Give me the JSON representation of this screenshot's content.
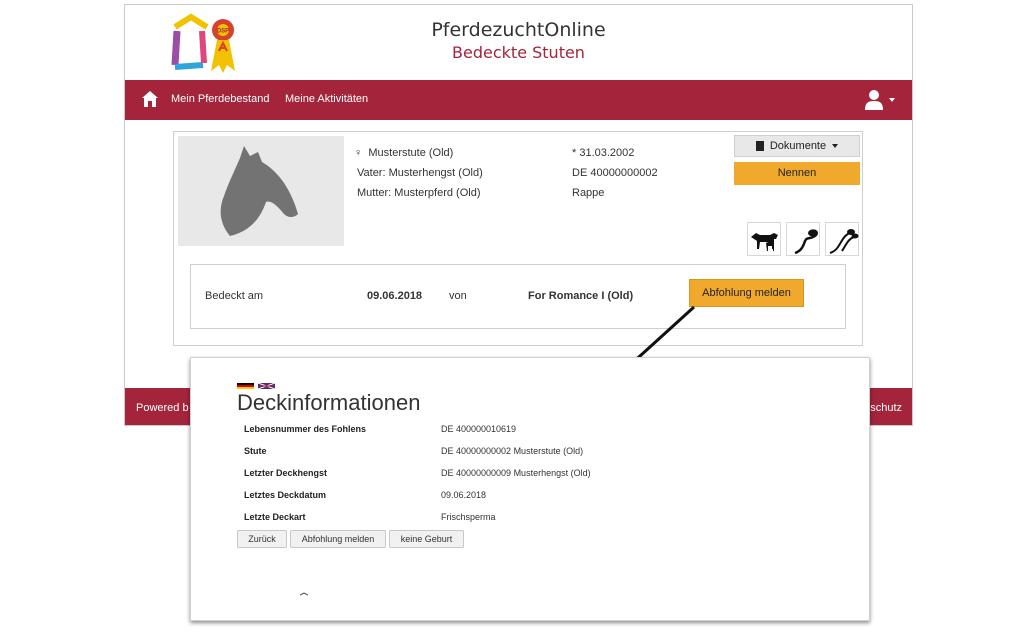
{
  "header": {
    "site_title": "PferdezuchtOnline",
    "page_subtitle": "Bedeckte Stuten",
    "logo_badge": "DSP"
  },
  "nav": {
    "items": [
      "Mein Pferdebestand",
      "Meine Aktivitäten"
    ]
  },
  "footer": {
    "left_text": "Powered b",
    "right_text": "schutz"
  },
  "horse": {
    "name": "Musterstute (Old)",
    "sire": "Vater: Musterhengst (Old)",
    "dam": "Mutter: Musterpferd (Old)",
    "birth": "* 31.03.2002",
    "id": "DE 40000000002",
    "color": "Rappe",
    "documents_label": "Dokumente",
    "nennen_label": "Nennen"
  },
  "mating": {
    "label": "Bedeckt am",
    "date": "09.06.2018",
    "by": "von",
    "stallion": "For Romance I (Old)",
    "report_button": "Abfohlung melden"
  },
  "overlay": {
    "title": "Deckinformationen",
    "rows": [
      {
        "label": "Lebensnummer des Fohlens",
        "value": "DE 400000010619"
      },
      {
        "label": "Stute",
        "value": "DE 40000000002 Musterstute (Old)"
      },
      {
        "label": "Letzter Deckhengst",
        "value": "DE 40000000009 Musterhengst (Old)"
      },
      {
        "label": "Letztes Deckdatum",
        "value": "09.06.2018"
      },
      {
        "label": "Letzte Deckart",
        "value": "Frischsperma"
      }
    ],
    "buttons": [
      "Zurück",
      "Abfohlung melden",
      "keine Geburt"
    ]
  },
  "colors": {
    "brand": "#a3243b",
    "accent": "#f0a92c"
  }
}
